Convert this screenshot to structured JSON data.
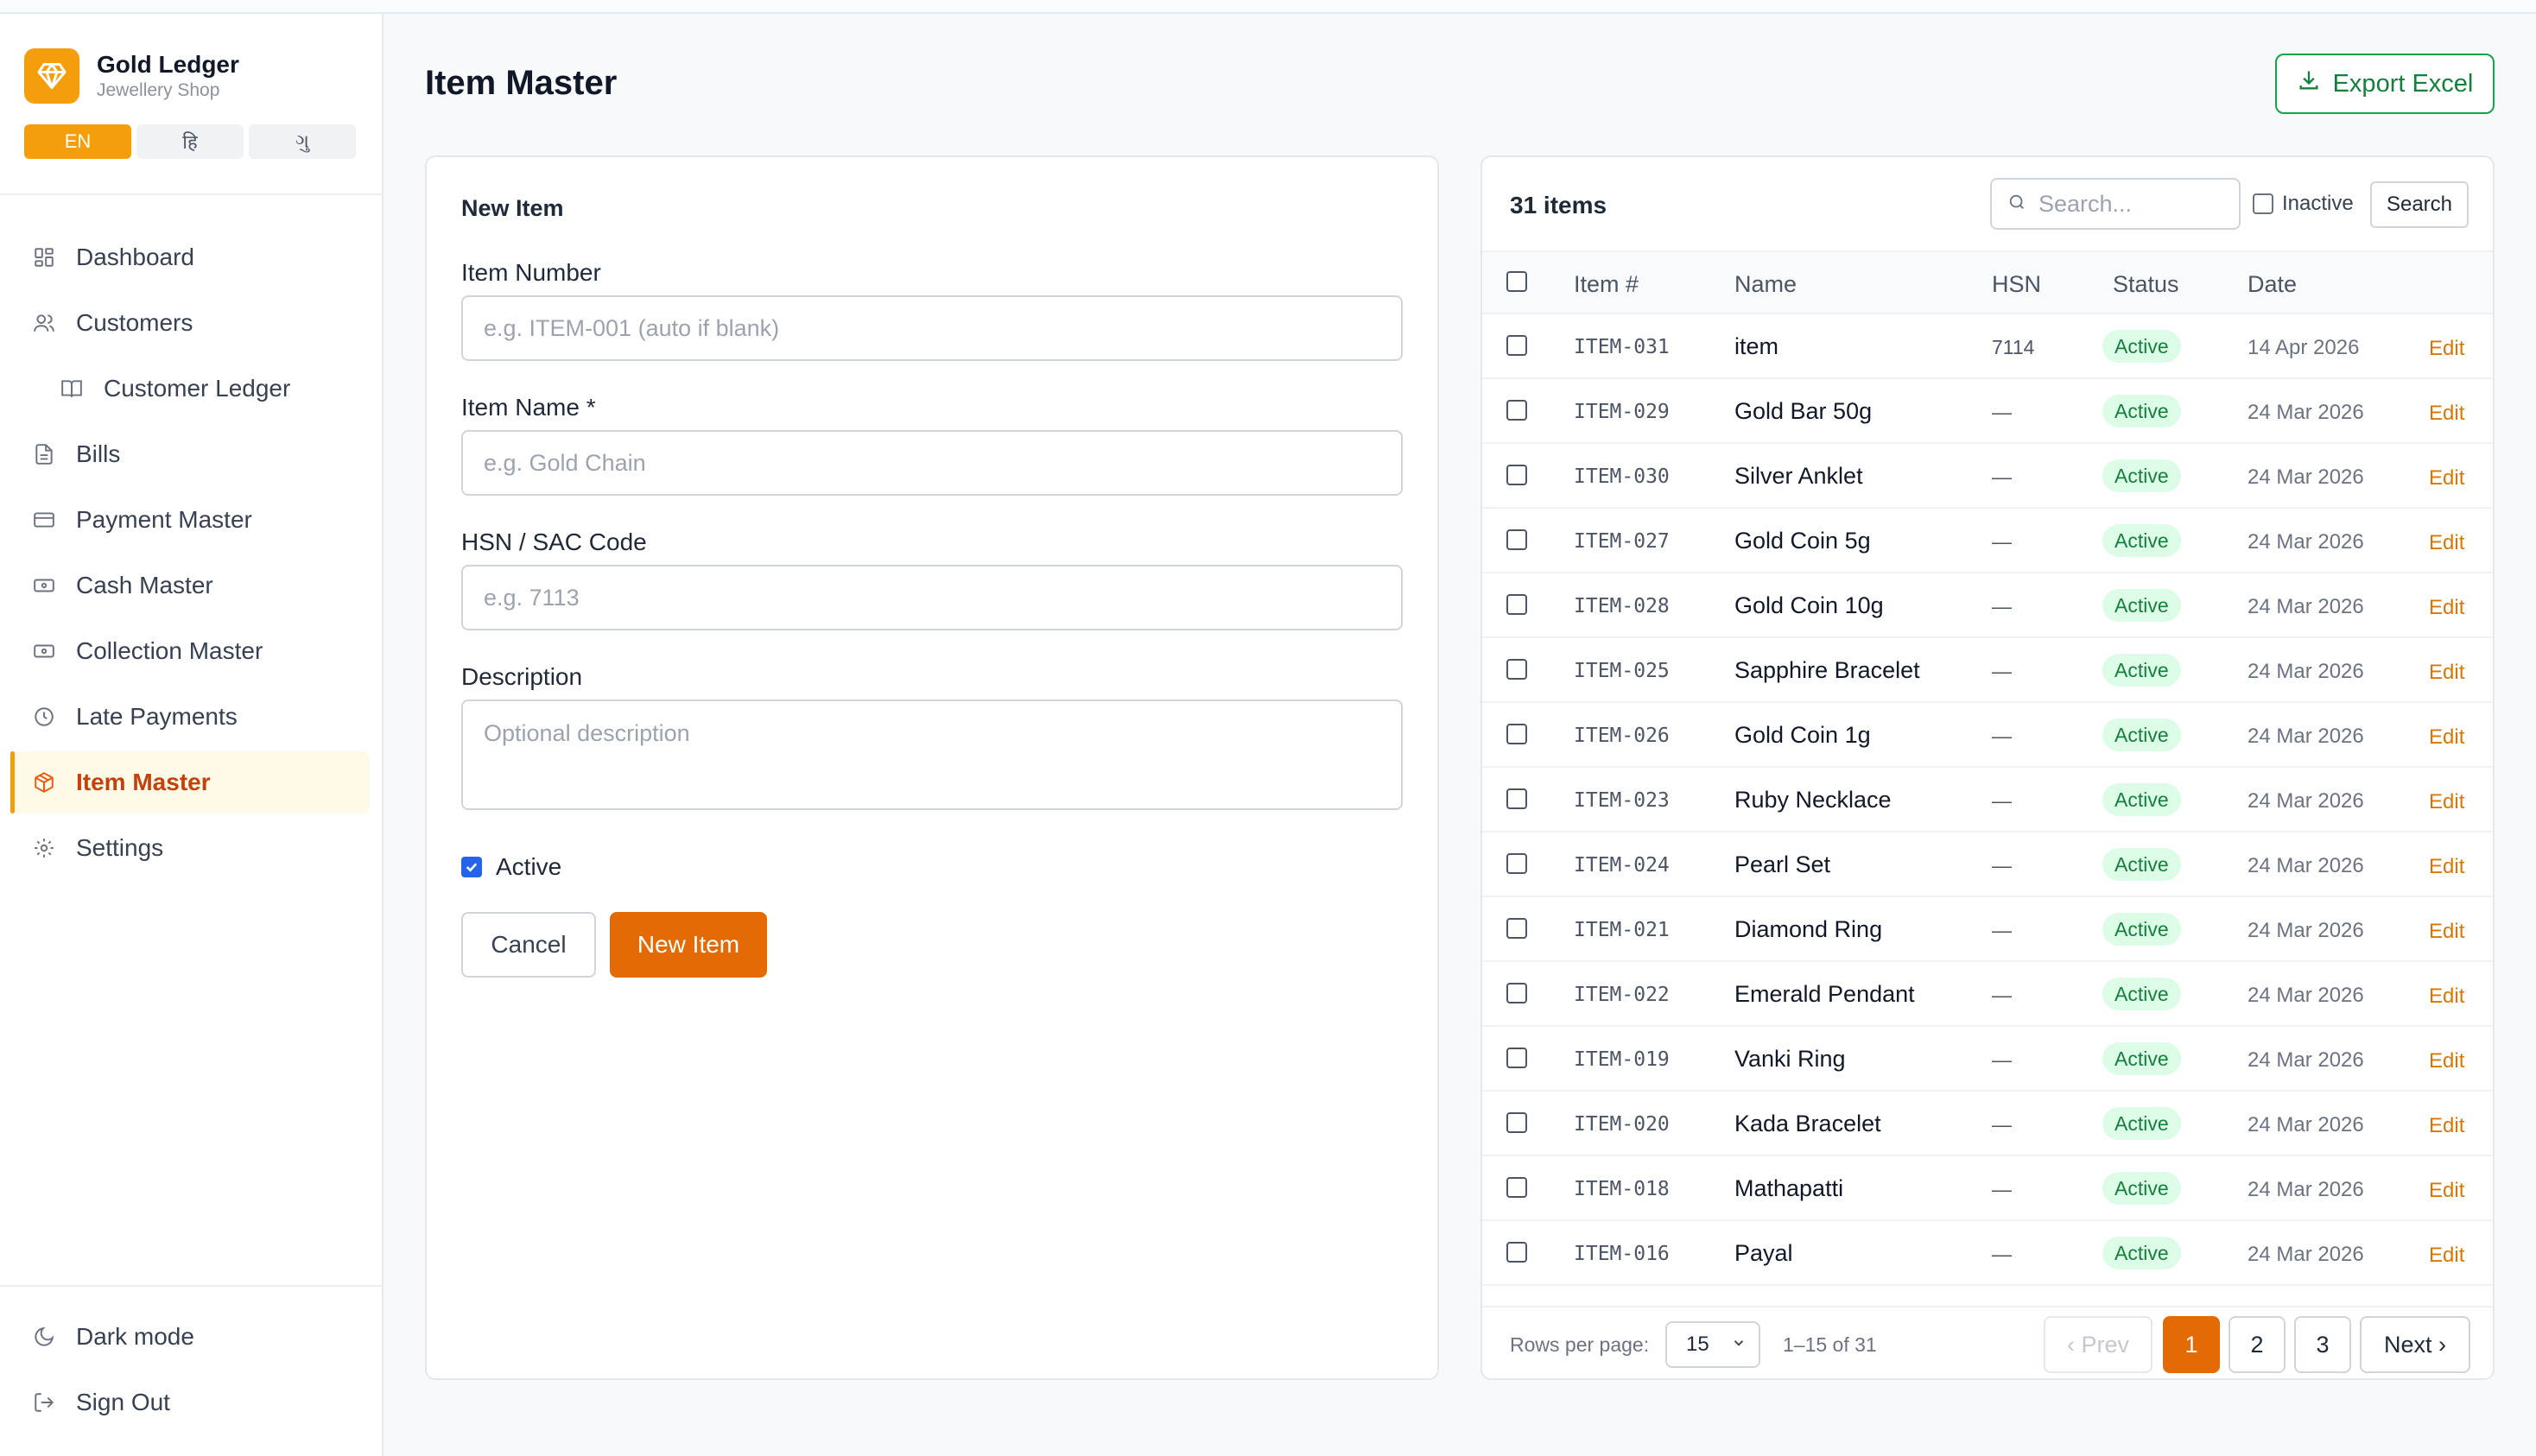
{
  "brand": {
    "title": "Gold Ledger",
    "subtitle": "Jewellery Shop"
  },
  "languages": [
    {
      "label": "EN",
      "active": true
    },
    {
      "label": "हि",
      "active": false
    },
    {
      "label": "ગુ",
      "active": false
    }
  ],
  "nav": [
    {
      "label": "Dashboard",
      "icon": "grid-icon"
    },
    {
      "label": "Customers",
      "icon": "users-icon"
    },
    {
      "label": "Customer Ledger",
      "icon": "book-icon"
    },
    {
      "label": "Bills",
      "icon": "document-icon"
    },
    {
      "label": "Payment Master",
      "icon": "card-icon"
    },
    {
      "label": "Cash Master",
      "icon": "cash-icon"
    },
    {
      "label": "Collection Master",
      "icon": "cash-icon"
    },
    {
      "label": "Late Payments",
      "icon": "clock-icon"
    },
    {
      "label": "Item Master",
      "icon": "box-icon"
    },
    {
      "label": "Settings",
      "icon": "gear-icon"
    }
  ],
  "nav_bottom": {
    "dark_mode": "Dark mode",
    "sign_out": "Sign Out"
  },
  "page": {
    "title": "Item Master",
    "export_label": "Export Excel"
  },
  "form": {
    "heading": "New Item",
    "item_number_label": "Item Number",
    "item_number_placeholder": "e.g. ITEM-001 (auto if blank)",
    "item_name_label": "Item Name *",
    "item_name_placeholder": "e.g. Gold Chain",
    "hsn_label": "HSN / SAC Code",
    "hsn_placeholder": "e.g. 7113",
    "description_label": "Description",
    "description_placeholder": "Optional description",
    "active_label": "Active",
    "active_checked": true,
    "cancel_label": "Cancel",
    "submit_label": "New Item"
  },
  "list": {
    "count_label": "31 items",
    "search_placeholder": "Search...",
    "inactive_label": "Inactive",
    "search_button": "Search",
    "columns": {
      "item": "Item #",
      "name": "Name",
      "hsn": "HSN",
      "status": "Status",
      "date": "Date"
    },
    "edit_label": "Edit",
    "rows": [
      {
        "code": "ITEM-031",
        "name": "item",
        "hsn": "7114",
        "status": "Active",
        "date": "14 Apr 2026"
      },
      {
        "code": "ITEM-029",
        "name": "Gold Bar 50g",
        "hsn": "—",
        "status": "Active",
        "date": "24 Mar 2026"
      },
      {
        "code": "ITEM-030",
        "name": "Silver Anklet",
        "hsn": "—",
        "status": "Active",
        "date": "24 Mar 2026"
      },
      {
        "code": "ITEM-027",
        "name": "Gold Coin 5g",
        "hsn": "—",
        "status": "Active",
        "date": "24 Mar 2026"
      },
      {
        "code": "ITEM-028",
        "name": "Gold Coin 10g",
        "hsn": "—",
        "status": "Active",
        "date": "24 Mar 2026"
      },
      {
        "code": "ITEM-025",
        "name": "Sapphire Bracelet",
        "hsn": "—",
        "status": "Active",
        "date": "24 Mar 2026"
      },
      {
        "code": "ITEM-026",
        "name": "Gold Coin 1g",
        "hsn": "—",
        "status": "Active",
        "date": "24 Mar 2026"
      },
      {
        "code": "ITEM-023",
        "name": "Ruby Necklace",
        "hsn": "—",
        "status": "Active",
        "date": "24 Mar 2026"
      },
      {
        "code": "ITEM-024",
        "name": "Pearl Set",
        "hsn": "—",
        "status": "Active",
        "date": "24 Mar 2026"
      },
      {
        "code": "ITEM-021",
        "name": "Diamond Ring",
        "hsn": "—",
        "status": "Active",
        "date": "24 Mar 2026"
      },
      {
        "code": "ITEM-022",
        "name": "Emerald Pendant",
        "hsn": "—",
        "status": "Active",
        "date": "24 Mar 2026"
      },
      {
        "code": "ITEM-019",
        "name": "Vanki Ring",
        "hsn": "—",
        "status": "Active",
        "date": "24 Mar 2026"
      },
      {
        "code": "ITEM-020",
        "name": "Kada Bracelet",
        "hsn": "—",
        "status": "Active",
        "date": "24 Mar 2026"
      },
      {
        "code": "ITEM-018",
        "name": "Mathapatti",
        "hsn": "—",
        "status": "Active",
        "date": "24 Mar 2026"
      },
      {
        "code": "ITEM-016",
        "name": "Payal",
        "hsn": "—",
        "status": "Active",
        "date": "24 Mar 2026"
      }
    ]
  },
  "pagination": {
    "rows_per_page_label": "Rows per page:",
    "rows_per_page_value": "15",
    "range_label": "1–15 of 31",
    "prev_label": "‹ Prev",
    "next_label": "Next ›",
    "pages": [
      "1",
      "2",
      "3"
    ],
    "current_page": "1"
  },
  "colors": {
    "accent": "#e46a05",
    "brand": "#f59e0b",
    "success": "#16a34a",
    "active_bg": "#dcfce7"
  }
}
